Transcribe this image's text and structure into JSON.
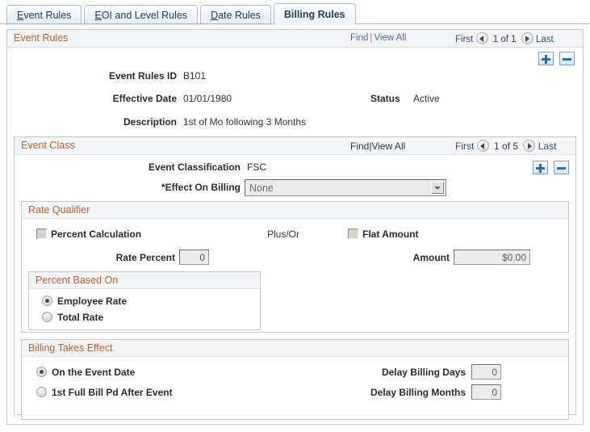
{
  "tabs": [
    {
      "label": "Event Rules",
      "accel": "E",
      "rest": "vent Rules",
      "active": false
    },
    {
      "label": "EOI and Level Rules",
      "accel": "E",
      "rest": "OI and Level Rules",
      "active": false
    },
    {
      "label": "Date Rules",
      "accel": "D",
      "rest": "ate Rules",
      "active": false
    },
    {
      "label": "Billing Rules",
      "accel": "",
      "rest": "Billing Rules",
      "active": true
    }
  ],
  "event_rules": {
    "title": "Event Rules",
    "find_label": "Find",
    "separator": "|",
    "view_all_label": "View All",
    "first_label": "First",
    "counter": "1 of 1",
    "last_label": "Last",
    "fields": {
      "event_rules_id_label": "Event Rules ID",
      "event_rules_id_value": "B101",
      "effective_date_label": "Effective Date",
      "effective_date_value": "01/01/1980",
      "status_label": "Status",
      "status_value": "Active",
      "description_label": "Description",
      "description_value": "1st of Mo following 3 Months"
    }
  },
  "event_class": {
    "title": "Event Class",
    "find_label": "Find",
    "separator": "|",
    "view_all_label": "View All",
    "first_label": "First",
    "counter": "1 of 5",
    "last_label": "Last",
    "event_classification_label": "Event Classification",
    "event_classification_value": "FSC",
    "effect_on_billing_label": "*Effect On Billing",
    "effect_on_billing_value": "None"
  },
  "rate_qualifier": {
    "title": "Rate Qualifier",
    "percent_calculation_label": "Percent Calculation",
    "percent_calculation_checked": false,
    "plus_or_label": "Plus/Or",
    "flat_amount_label": "Flat Amount",
    "flat_amount_checked": false,
    "rate_percent_label": "Rate Percent",
    "rate_percent_value": "0",
    "amount_label": "Amount",
    "amount_value": "$0.00"
  },
  "percent_based_on": {
    "title": "Percent Based On",
    "options": [
      {
        "label": "Employee Rate",
        "selected": true
      },
      {
        "label": "Total Rate",
        "selected": false
      }
    ]
  },
  "billing_takes_effect": {
    "title": "Billing Takes Effect",
    "options": [
      {
        "label": "On the Event Date",
        "selected": true
      },
      {
        "label": "1st Full Bill Pd After Event",
        "selected": false
      }
    ],
    "delay_billing_days_label": "Delay Billing Days",
    "delay_billing_days_value": "0",
    "delay_billing_months_label": "Delay Billing Months",
    "delay_billing_months_value": "0"
  },
  "icons": {
    "prev_arrow": "left-arrow-circle-icon",
    "next_arrow": "right-arrow-circle-icon",
    "add_row": "plus-icon",
    "delete_row": "minus-icon",
    "dropdown": "chevron-down-icon"
  },
  "colors": {
    "group_title": "#c1622a",
    "link": "#4a6c9b",
    "tab_text": "#1f3d66",
    "plus_minus": "#2f6cb5"
  }
}
